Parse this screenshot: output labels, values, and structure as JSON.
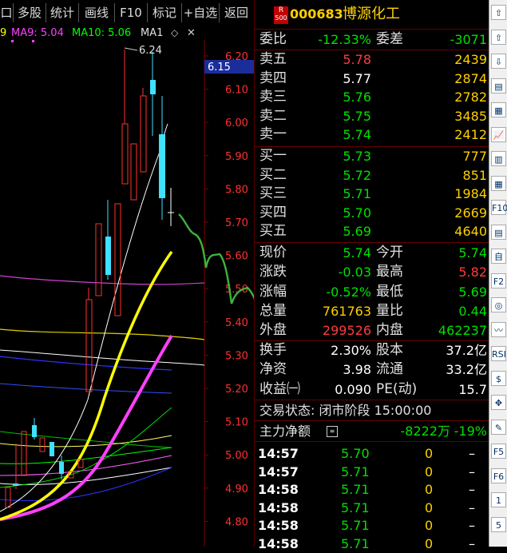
{
  "toolbar": {
    "items": [
      "口",
      "多股",
      "统计",
      "画线",
      "F10",
      "标记",
      "+自选",
      "返回"
    ]
  },
  "ma": {
    "ma9_prefix": "9",
    "ma9": "MA9: 5.04",
    "ma10": "MA10: 5.06",
    "ma1": "MA1",
    "peak_label": "6.24",
    "cursor_price": "6.15"
  },
  "yaxis": [
    "6.20",
    "6.10",
    "6.00",
    "5.90",
    "5.80",
    "5.70",
    "5.60",
    "5.50",
    "5.40",
    "5.30",
    "5.20",
    "5.10",
    "5.00",
    "4.90",
    "4.80"
  ],
  "stock": {
    "badge_top": "R",
    "badge_bottom": "500",
    "code": "000683",
    "name": "博源化工"
  },
  "weibi": {
    "label": "委比",
    "value": "-12.33%",
    "diff_label": "委差",
    "diff_value": "-3071"
  },
  "asks": [
    {
      "label": "卖五",
      "price": "5.78",
      "vol": "2439"
    },
    {
      "label": "卖四",
      "price": "5.77",
      "vol": "2874"
    },
    {
      "label": "卖三",
      "price": "5.76",
      "vol": "2782"
    },
    {
      "label": "卖二",
      "price": "5.75",
      "vol": "3485"
    },
    {
      "label": "卖一",
      "price": "5.74",
      "vol": "2412"
    }
  ],
  "bids": [
    {
      "label": "买一",
      "price": "5.73",
      "vol": "777"
    },
    {
      "label": "买二",
      "price": "5.72",
      "vol": "851"
    },
    {
      "label": "买三",
      "price": "5.71",
      "vol": "1984"
    },
    {
      "label": "买四",
      "price": "5.70",
      "vol": "2669"
    },
    {
      "label": "买五",
      "price": "5.69",
      "vol": "4640"
    }
  ],
  "stats": [
    {
      "l1": "现价",
      "v1": "5.74",
      "l2": "今开",
      "v2": "5.74"
    },
    {
      "l1": "涨跌",
      "v1": "-0.03",
      "l2": "最高",
      "v2": "5.82"
    },
    {
      "l1": "涨幅",
      "v1": "-0.52%",
      "l2": "最低",
      "v2": "5.69"
    },
    {
      "l1": "总量",
      "v1": "761763",
      "l2": "量比",
      "v2": "0.44"
    },
    {
      "l1": "外盘",
      "v1": "299526",
      "l2": "内盘",
      "v2": "462237"
    }
  ],
  "stats2": [
    {
      "l1": "换手",
      "v1": "2.30%",
      "l2": "股本",
      "v2": "37.2亿"
    },
    {
      "l1": "净资",
      "v1": "3.98",
      "l2": "流通",
      "v2": "33.2亿"
    },
    {
      "l1": "收益㈠",
      "v1": "0.090",
      "l2": "PE(动)",
      "v2": "15.7"
    }
  ],
  "trade_status": "交易状态: 闭市阶段 15:00:00",
  "mainforce": {
    "label": "主力净额",
    "value": "-8222万",
    "pct": "-19%"
  },
  "ticks": [
    {
      "time": "14:57",
      "price": "5.70",
      "vol": "0",
      "flag": "–"
    },
    {
      "time": "14:57",
      "price": "5.71",
      "vol": "0",
      "flag": "–"
    },
    {
      "time": "14:58",
      "price": "5.71",
      "vol": "0",
      "flag": "–"
    },
    {
      "time": "14:58",
      "price": "5.71",
      "vol": "0",
      "flag": "–"
    },
    {
      "time": "14:58",
      "price": "5.71",
      "vol": "0",
      "flag": "–"
    },
    {
      "time": "14:58",
      "price": "5.71",
      "vol": "0",
      "flag": "–"
    }
  ],
  "side_icons": [
    "up-arrow-icon",
    "up-icon",
    "down-icon",
    "list-icon",
    "grid-icon",
    "chart-icon",
    "candle-icon",
    "table-icon",
    "f10-icon",
    "doc-icon",
    "self-icon",
    "f2-icon",
    "circle-icon",
    "wave-icon",
    "rsi-icon",
    "dollar-icon",
    "move-icon",
    "pen-icon",
    "f5-icon",
    "f6-icon",
    "one-icon",
    "five-icon"
  ],
  "side_labels": [
    "⇧",
    "⇧",
    "⇩",
    "▤",
    "▦",
    "📈",
    "▥",
    "▦",
    "F10",
    "▤",
    "自",
    "F2",
    "◎",
    "〰",
    "RSI",
    "$",
    "✥",
    "✎",
    "F5",
    "F6",
    "1",
    "5"
  ]
}
